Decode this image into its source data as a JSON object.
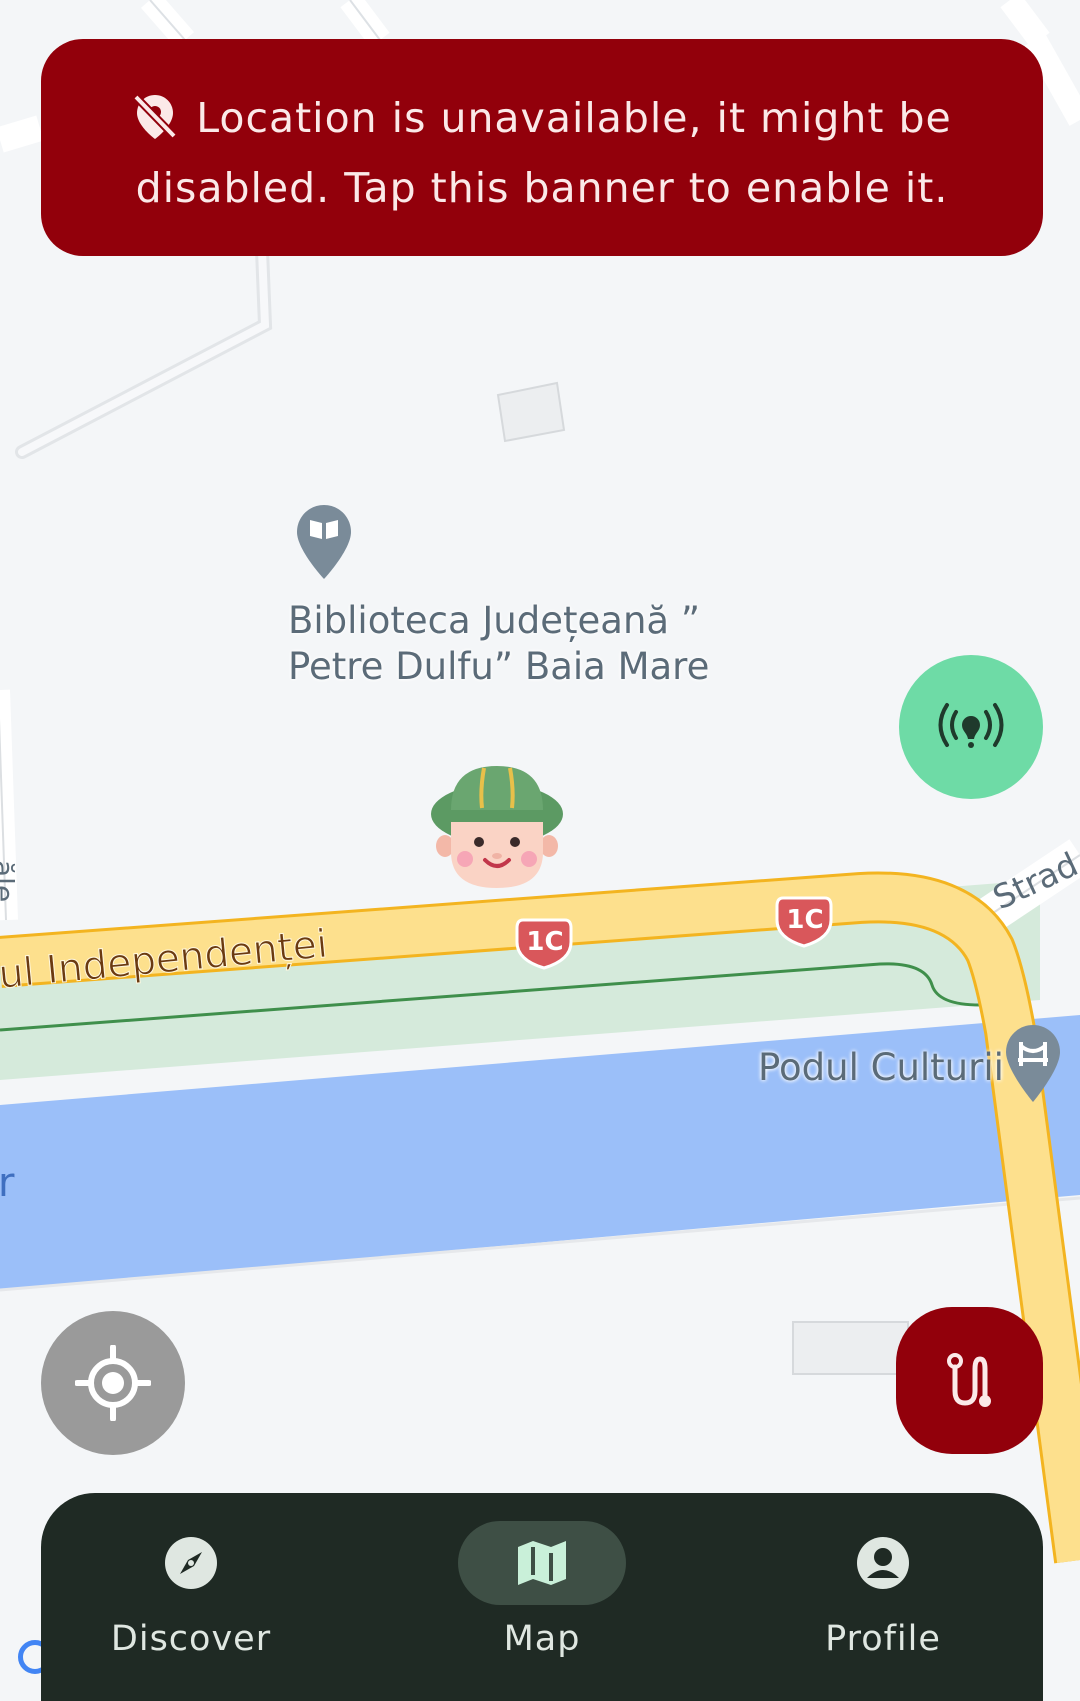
{
  "banner": {
    "icon": "location-off-icon",
    "text": "Location is unavailable, it might be disabled. Tap this banner to enable it."
  },
  "map": {
    "poi_label": "Biblioteca Județeană ”\nPetre Dulfu” Baia Mare",
    "poi_icon": "book-pin-icon",
    "street_main": "ul Independenței",
    "street_side": "Strad",
    "road_shield": "1C",
    "bridge_label": "Podul Culturii",
    "bridge_icon": "bridge-pin-icon",
    "river_fragment": "r",
    "side_street_fragment": "ăle"
  },
  "fabs": {
    "broadcast": "broadcast-icon",
    "locate": "my-location-icon",
    "route": "route-icon"
  },
  "nav": {
    "items": [
      {
        "label": "Discover",
        "icon": "compass-icon",
        "active": false
      },
      {
        "label": "Map",
        "icon": "map-icon",
        "active": true
      },
      {
        "label": "Profile",
        "icon": "account-icon",
        "active": false
      }
    ]
  },
  "colors": {
    "banner_bg": "#92000b",
    "broadcast_fab": "#6edba6",
    "locate_fab": "#9a9a9a",
    "nav_bg": "#1f2a24",
    "road": "#fde08d",
    "river": "#9bbff9",
    "park": "#d5eadb"
  }
}
